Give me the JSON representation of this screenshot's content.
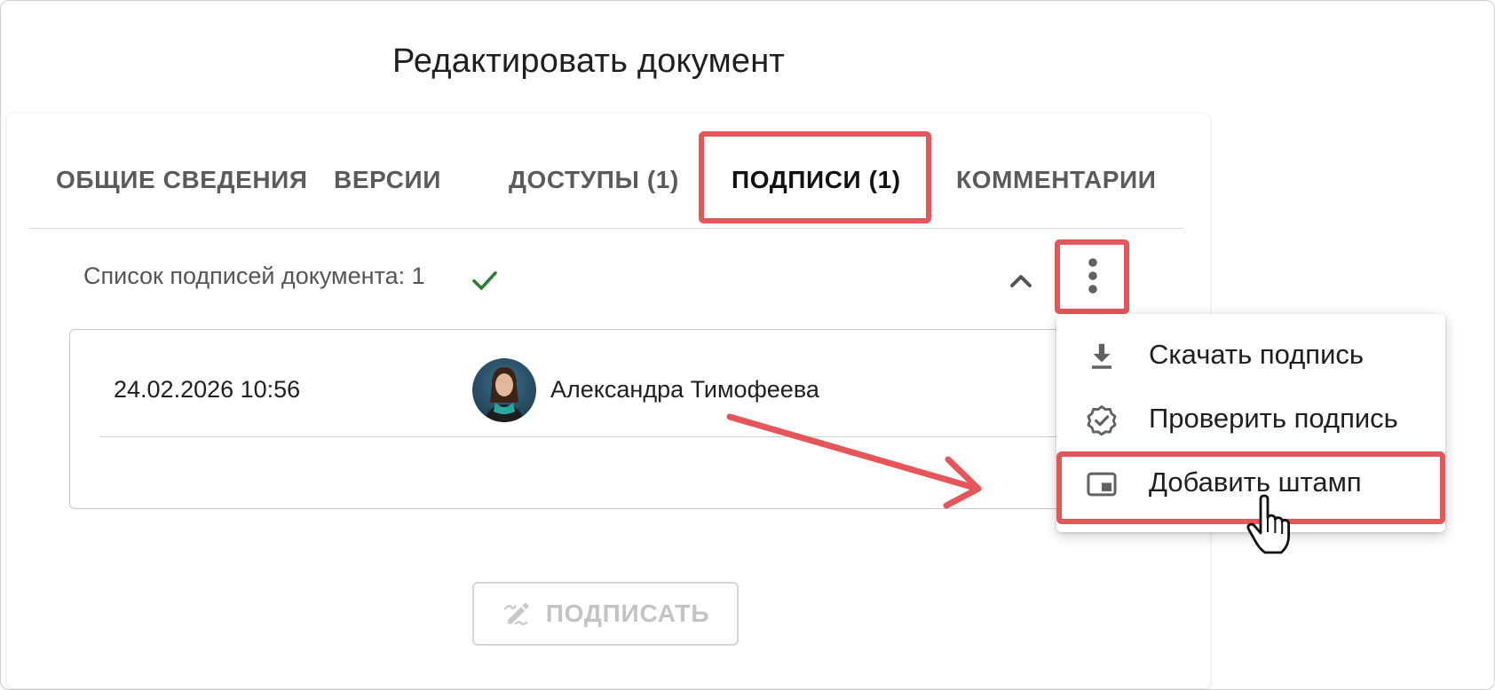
{
  "page": {
    "title": "Редактировать документ"
  },
  "tabs": [
    {
      "label": "ОБЩИЕ СВЕДЕНИЯ",
      "active": false
    },
    {
      "label": "ВЕРСИИ",
      "active": false
    },
    {
      "label": "ДОСТУПЫ (1)",
      "active": false
    },
    {
      "label": "ПОДПИСИ (1)",
      "active": true
    },
    {
      "label": "КОММЕНТАРИИ",
      "active": false
    }
  ],
  "signatures": {
    "list_label": "Список подписей документа: 1",
    "rows": [
      {
        "date": "24.02.2026 10:56",
        "signer": "Александра Тимофеева"
      }
    ]
  },
  "menu": {
    "items": [
      {
        "label": "Скачать подпись",
        "icon": "download-icon"
      },
      {
        "label": "Проверить подпись",
        "icon": "verified-badge-icon"
      },
      {
        "label": "Добавить штамп",
        "icon": "stamp-icon"
      }
    ]
  },
  "actions": {
    "sign_label": "ПОДПИСАТЬ"
  },
  "colors": {
    "highlight": "#e4565a",
    "check": "#2e7d32",
    "tab_active": "#111111",
    "tab_inactive": "#5b5b5b",
    "disabled": "#c3c3c3"
  }
}
